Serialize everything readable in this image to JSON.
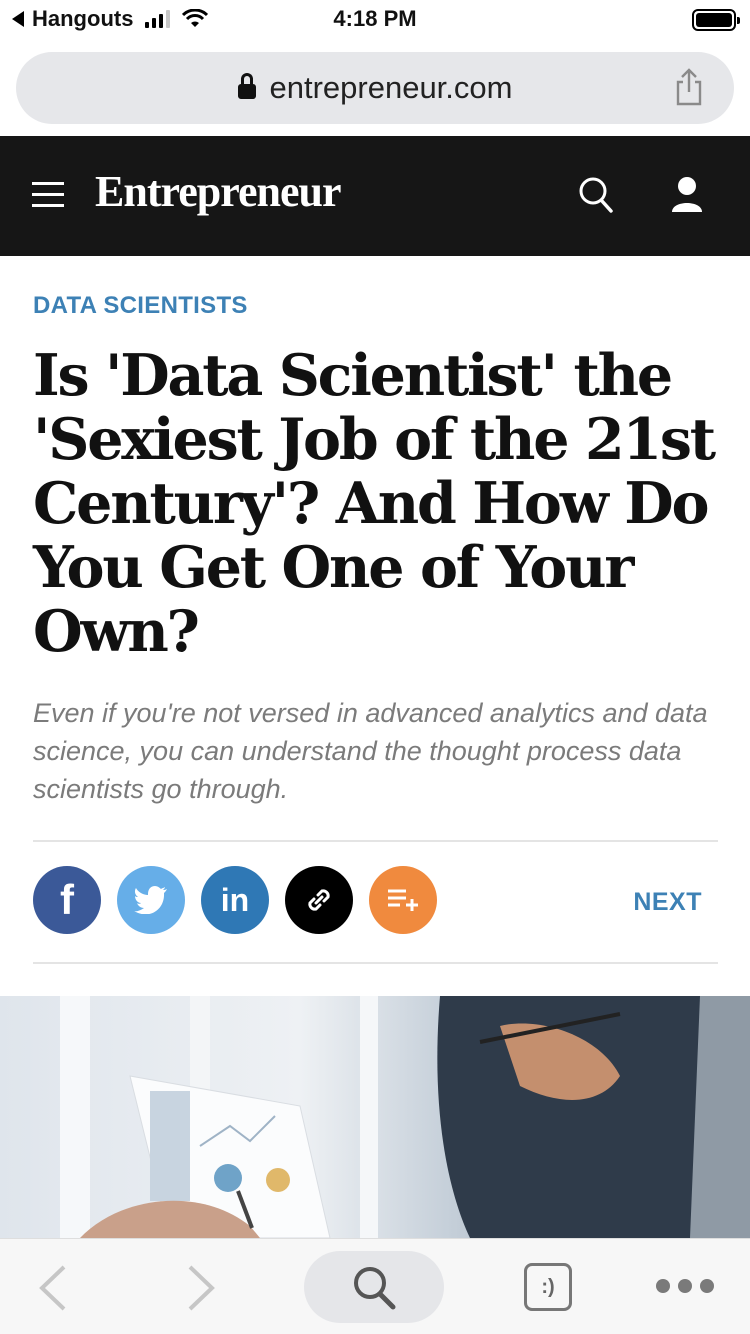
{
  "status_bar": {
    "back_app": "Hangouts",
    "time": "4:18 PM"
  },
  "browser": {
    "url": "entrepreneur.com"
  },
  "site": {
    "logo": "Entrepreneur"
  },
  "article": {
    "category": "DATA SCIENTISTS",
    "headline": "Is 'Data Scientist' the 'Sexiest Job of the 21st Century'? And How Do You Get One of Your Own?",
    "dek": "Even if you're not versed in advanced analytics and data science, you can understand the thought process data scientists go through."
  },
  "share": {
    "facebook_glyph": "f",
    "linkedin_glyph": "in",
    "next_label": "NEXT"
  },
  "toolbar": {
    "tabs_label": ":)"
  },
  "colors": {
    "accent_blue": "#3d81b5",
    "header_bg": "#161616",
    "facebook": "#3b5998",
    "twitter": "#66aee8",
    "linkedin": "#2f78b5",
    "readlater": "#f08a3e"
  },
  "icons": [
    "back-arrow-icon",
    "signal-icon",
    "wifi-icon",
    "battery-icon",
    "lock-icon",
    "share-icon",
    "menu-icon",
    "search-icon",
    "user-icon",
    "facebook-icon",
    "twitter-icon",
    "linkedin-icon",
    "link-icon",
    "add-to-list-icon",
    "chevron-left-icon",
    "chevron-right-icon",
    "tabs-icon",
    "more-icon"
  ]
}
